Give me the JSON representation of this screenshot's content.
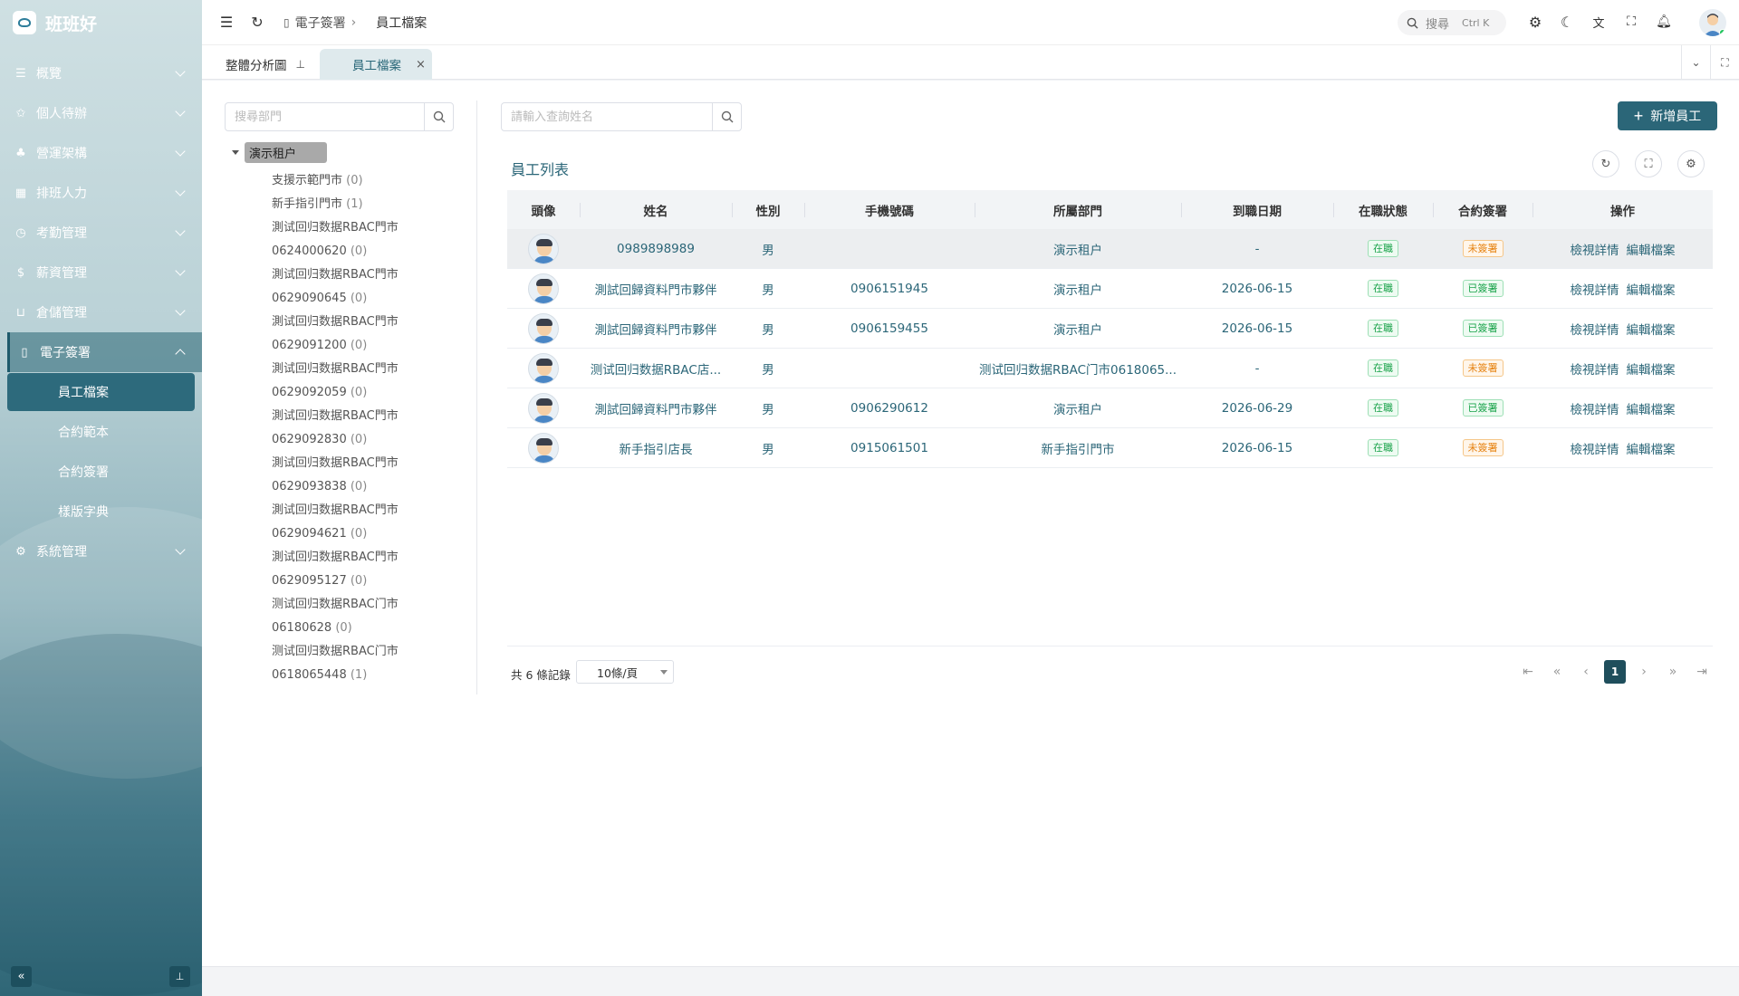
{
  "app": {
    "name": "班班好"
  },
  "sidebar": {
    "items": [
      {
        "label": "概覽",
        "icon": "list-icon"
      },
      {
        "label": "個人待辦",
        "icon": "pin-icon"
      },
      {
        "label": "營運架構",
        "icon": "org-icon"
      },
      {
        "label": "排班人力",
        "icon": "calendar-icon"
      },
      {
        "label": "考勤管理",
        "icon": "clock-icon"
      },
      {
        "label": "薪資管理",
        "icon": "dollar-icon"
      },
      {
        "label": "倉儲管理",
        "icon": "cart-icon"
      },
      {
        "label": "電子簽署",
        "icon": "document-icon"
      }
    ],
    "sub_items": [
      "員工檔案",
      "合約範本",
      "合約簽署",
      "樣版字典"
    ],
    "last_item": {
      "label": "系統管理",
      "icon": "gear-icon"
    },
    "collapse_glyph": "«",
    "pin_glyph": "⊥"
  },
  "header": {
    "breadcrumb": [
      "電子簽署",
      "員工檔案"
    ],
    "search_label": "搜尋",
    "search_shortcut": "Ctrl K"
  },
  "tabs": [
    {
      "label": "整體分析圖",
      "pinned": true
    },
    {
      "label": "員工檔案",
      "active": true
    }
  ],
  "tree": {
    "search_placeholder": "搜尋部門",
    "root": "演示租户",
    "nodes": [
      {
        "line1": "支援示範門市",
        "line2": "",
        "count": "(0)"
      },
      {
        "line1": "新手指引門市",
        "line2": "",
        "count": "(1)"
      },
      {
        "line1": "測试回归数据RBAC門市",
        "line2": "0624000620",
        "count": "(0)"
      },
      {
        "line1": "測试回归数据RBAC門市",
        "line2": "0629090645",
        "count": "(0)"
      },
      {
        "line1": "測试回归数据RBAC門市",
        "line2": "0629091200",
        "count": "(0)"
      },
      {
        "line1": "測试回归数据RBAC門市",
        "line2": "0629092059",
        "count": "(0)"
      },
      {
        "line1": "測试回归数据RBAC門市",
        "line2": "0629092830",
        "count": "(0)"
      },
      {
        "line1": "測试回归数据RBAC門市",
        "line2": "0629093838",
        "count": "(0)"
      },
      {
        "line1": "測试回归数据RBAC門市",
        "line2": "0629094621",
        "count": "(0)"
      },
      {
        "line1": "測试回归数据RBAC門市",
        "line2": "0629095127",
        "count": "(0)"
      },
      {
        "line1": "测试回归数据RBAC门市",
        "line2": "06180628",
        "count": "(0)"
      },
      {
        "line1": "测试回归数据RBAC门市",
        "line2": "0618065448",
        "count": "(1)"
      }
    ]
  },
  "main": {
    "search_placeholder": "請輸入查詢姓名",
    "add_button": "新增員工",
    "list_title": "員工列表",
    "columns": [
      "頭像",
      "姓名",
      "性別",
      "手機號碼",
      "所屬部門",
      "到職日期",
      "在職狀態",
      "合約簽署",
      "操作"
    ],
    "rows": [
      {
        "name": "0989898989",
        "gender": "男",
        "phone": "",
        "dept": "演示租户",
        "date": "-",
        "status": "在職",
        "contract": "未簽署",
        "contract_color": "orange"
      },
      {
        "name": "測試回歸資料門市夥伴",
        "gender": "男",
        "phone": "0906151945",
        "dept": "演示租户",
        "date": "2026-06-15",
        "status": "在職",
        "contract": "已簽署",
        "contract_color": "green"
      },
      {
        "name": "測試回歸資料門市夥伴",
        "gender": "男",
        "phone": "0906159455",
        "dept": "演示租户",
        "date": "2026-06-15",
        "status": "在職",
        "contract": "已簽署",
        "contract_color": "green"
      },
      {
        "name": "测试回归数据RBAC店...",
        "gender": "男",
        "phone": "",
        "dept": "测试回归数据RBAC门市0618065...",
        "date": "-",
        "status": "在職",
        "contract": "未簽署",
        "contract_color": "orange"
      },
      {
        "name": "測試回歸資料門市夥伴",
        "gender": "男",
        "phone": "0906290612",
        "dept": "演示租户",
        "date": "2026-06-29",
        "status": "在職",
        "contract": "已簽署",
        "contract_color": "green"
      },
      {
        "name": "新手指引店長",
        "gender": "男",
        "phone": "0915061501",
        "dept": "新手指引門市",
        "date": "2026-06-15",
        "status": "在職",
        "contract": "未簽署",
        "contract_color": "orange"
      }
    ],
    "ops": [
      "檢視詳情",
      "編輯檔案"
    ],
    "total_text": "共 6 條記錄",
    "page_size": "10條/頁",
    "current_page": "1"
  },
  "colors": {
    "primary": "#2b6678",
    "success": "#19a34a",
    "warning": "#e6810e"
  }
}
